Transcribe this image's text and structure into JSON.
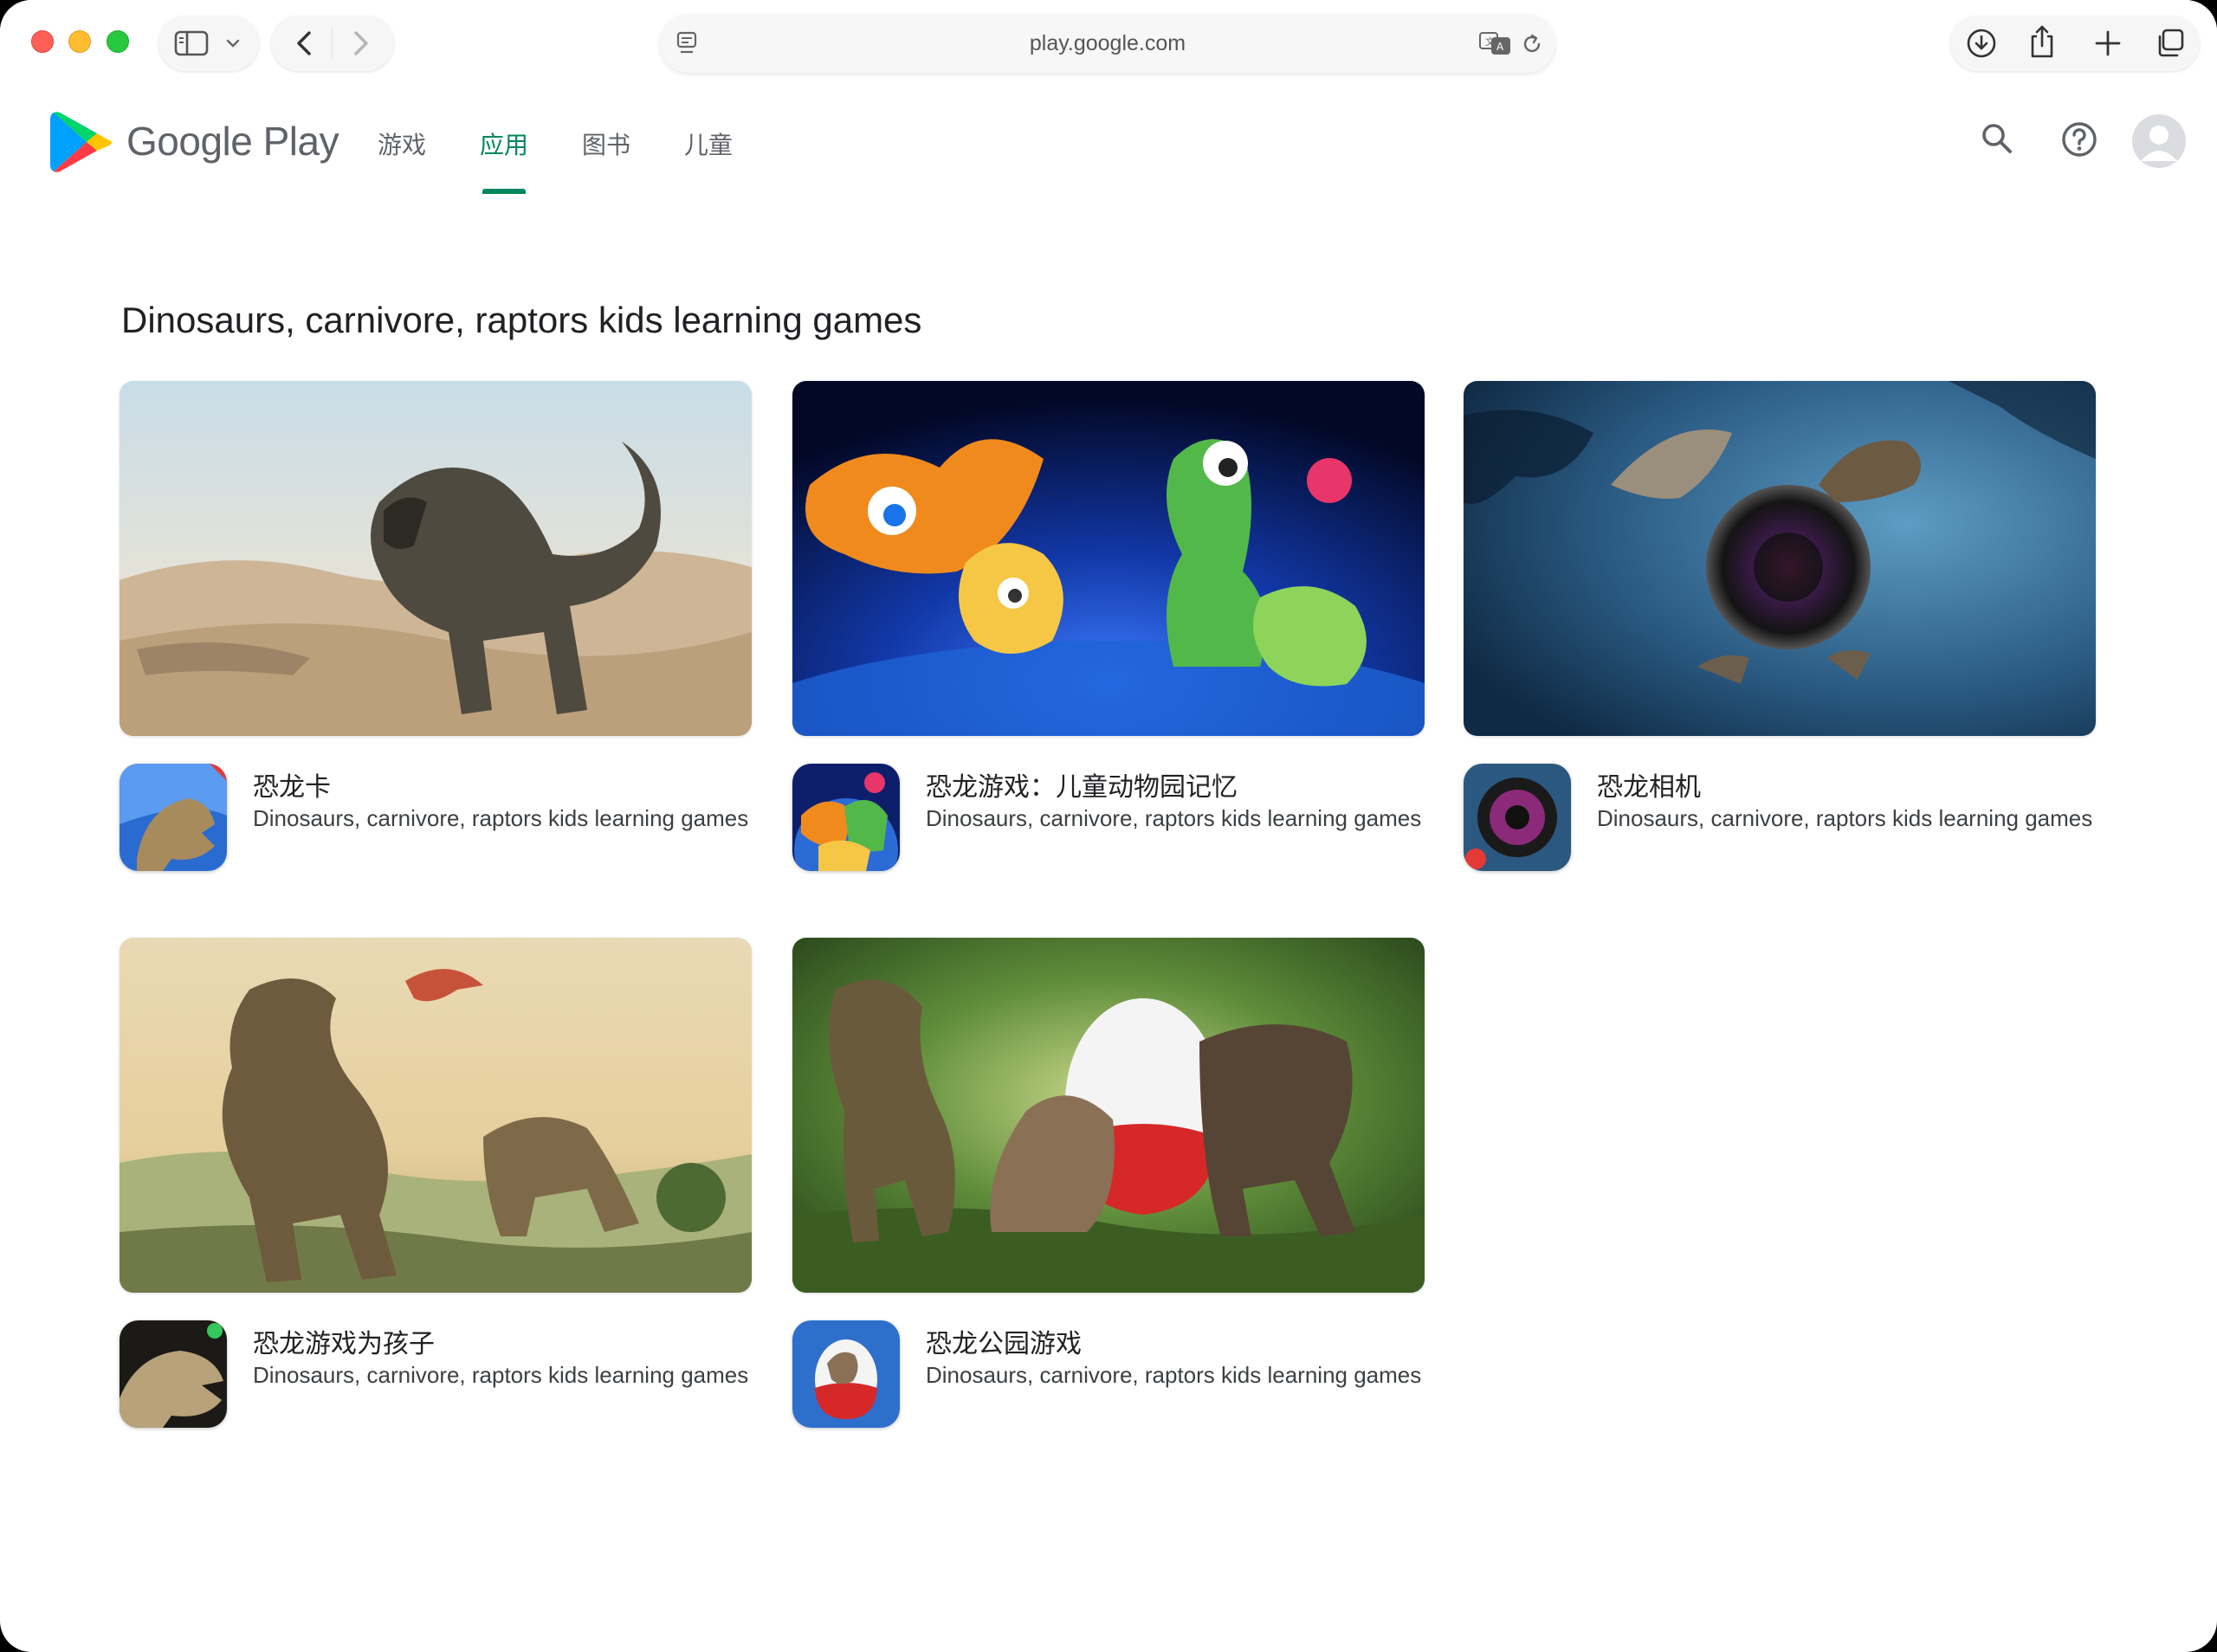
{
  "browser": {
    "url": "play.google.com"
  },
  "play": {
    "brand": "Google Play",
    "tabs": [
      {
        "label": "游戏",
        "active": false
      },
      {
        "label": "应用",
        "active": true
      },
      {
        "label": "图书",
        "active": false
      },
      {
        "label": "儿童",
        "active": false
      }
    ],
    "accent_color": "#01875f"
  },
  "section": {
    "title": "Dinosaurs, carnivore, raptors kids learning games"
  },
  "apps": [
    {
      "name": "恐龙卡",
      "developer": "Dinosaurs, carnivore, raptors kids learning games"
    },
    {
      "name": "恐龙游戏：儿童动物园记忆",
      "developer": "Dinosaurs, carnivore, raptors kids learning games"
    },
    {
      "name": "恐龙相机",
      "developer": "Dinosaurs, carnivore, raptors kids learning games"
    },
    {
      "name": "恐龙游戏为孩子",
      "developer": "Dinosaurs, carnivore, raptors kids learning games"
    },
    {
      "name": "恐龙公园游戏",
      "developer": "Dinosaurs, carnivore, raptors kids learning games"
    }
  ]
}
